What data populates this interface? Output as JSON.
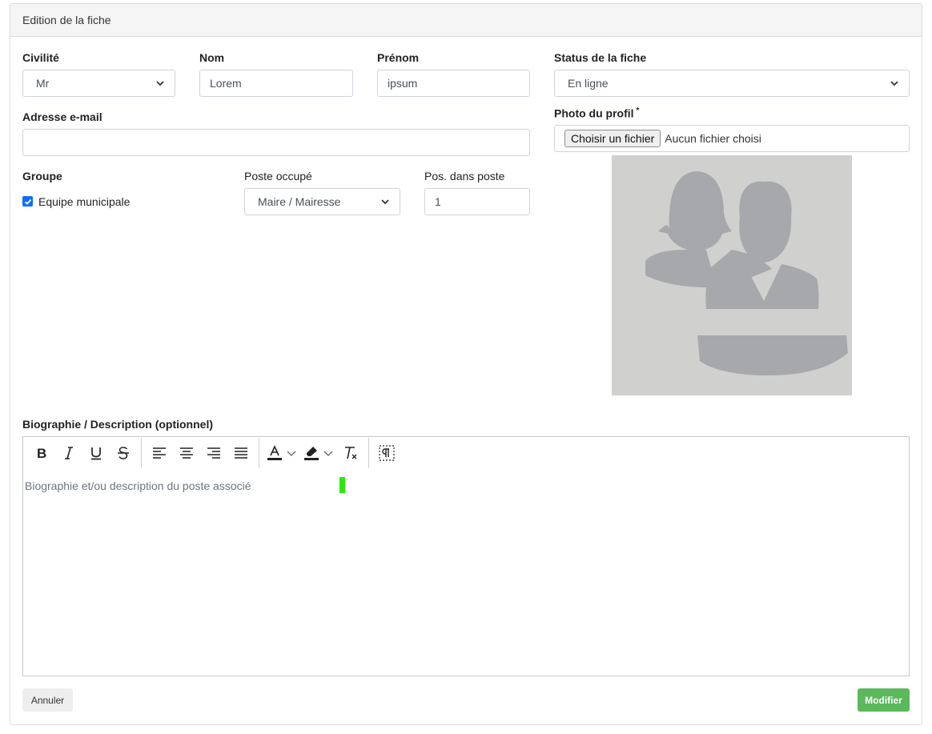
{
  "card": {
    "header": "Edition de la fiche"
  },
  "civilite": {
    "label": "Civilité",
    "value": "Mr"
  },
  "nom": {
    "label": "Nom",
    "value": "Lorem"
  },
  "prenom": {
    "label": "Prénom",
    "value": "ipsum"
  },
  "status": {
    "label": "Status de la fiche",
    "value": "En ligne"
  },
  "email": {
    "label": "Adresse e-mail",
    "value": ""
  },
  "photo": {
    "label": "Photo du profil",
    "required_mark": "*",
    "button": "Choisir un fichier",
    "status": "Aucun fichier choisi",
    "placeholder_icon": "people-silhouette-icon"
  },
  "groupe": {
    "label": "Groupe",
    "checkbox_label": "Equipe municipale",
    "checked": true
  },
  "poste": {
    "label": "Poste occupé",
    "value": "Maire / Mairesse"
  },
  "position": {
    "label": "Pos. dans poste",
    "value": "1"
  },
  "bio": {
    "label": "Biographie / Description (optionnel)",
    "placeholder": "Biographie et/ou description du poste associé"
  },
  "toolbar": {
    "icons": [
      "bold-icon",
      "italic-icon",
      "underline-icon",
      "strikethrough-icon",
      "align-left-icon",
      "align-center-icon",
      "align-right-icon",
      "align-justify-icon",
      "text-color-icon",
      "highlight-color-icon",
      "clear-format-icon",
      "paragraph-marks-icon"
    ]
  },
  "buttons": {
    "cancel": "Annuler",
    "submit": "Modifier"
  },
  "colors": {
    "accent": "#0d6efd",
    "submit": "#5cb85c",
    "avatar_bg": "#d0d0cf",
    "avatar_figure": "#a7a8ab",
    "cursor_marker": "#2ee60b"
  }
}
